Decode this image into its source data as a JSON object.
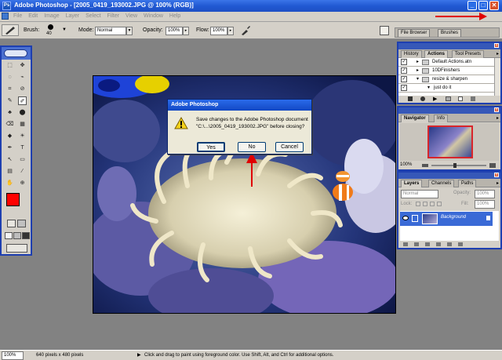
{
  "titlebar": {
    "app_icon": "Ps",
    "title": "Adobe Photoshop - [2005_0419_193002.JPG @ 100% (RGB)]",
    "buttons": {
      "minimize": "_",
      "maximize": "□",
      "close": "✕"
    }
  },
  "menubar": {
    "items": [
      "File",
      "Edit",
      "Image",
      "Layer",
      "Select",
      "Filter",
      "View",
      "Window",
      "Help"
    ]
  },
  "options": {
    "brush_label": "Brush:",
    "brush_size": "40",
    "mode_label": "Mode:",
    "mode_value": "Normal",
    "opacity_label": "Opacity:",
    "opacity_value": "100%",
    "flow_label": "Flow:",
    "flow_value": "100%",
    "tabs": [
      "File Browser",
      "Brushes"
    ]
  },
  "toolbox": {
    "tools": [
      "⬚",
      "✥",
      "◌",
      "⌁",
      "⌗",
      "⊘",
      "✎",
      "✐",
      "♣",
      "⬤",
      "⌫",
      "▦",
      "◆",
      "☀",
      "✒",
      "T",
      "↖",
      "▭",
      "▤",
      "⁄",
      "✋",
      "⊕"
    ]
  },
  "actions_panel": {
    "tabs": [
      "History",
      "Actions",
      "Tool Presets"
    ],
    "rows": [
      "Default Actions.atn",
      "10DFinishers",
      "resize & sharpen",
      "just do it"
    ]
  },
  "navigator_panel": {
    "tabs": [
      "Navigator",
      "Info"
    ],
    "zoom": "100%"
  },
  "layers_panel": {
    "tabs": [
      "Layers",
      "Channels",
      "Paths"
    ],
    "blend_mode": "Normal",
    "opacity_label": "Opacity:",
    "opacity_value": "100%",
    "lock_label": "Lock:",
    "fill_label": "Fill:",
    "fill_value": "100%",
    "layer_name": "Background"
  },
  "dialog": {
    "title": "Adobe Photoshop",
    "message_line1": "Save changes to the Adobe Photoshop document",
    "message_line2": "\"C:\\...\\2005_0419_193002.JPG\" before closing?",
    "buttons": {
      "yes": "Yes",
      "no": "No",
      "cancel": "Cancel"
    }
  },
  "statusbar": {
    "zoom": "100%",
    "doc_size": "640 pixels x 480 pixels",
    "hint": "Click and drag to paint using foreground color.  Use Shift, Alt, and Ctrl for additional options."
  },
  "colors": {
    "title_blue": "#2159d3",
    "foreground_swatch": "#ff0000",
    "annotation_arrow": "#e00000"
  }
}
